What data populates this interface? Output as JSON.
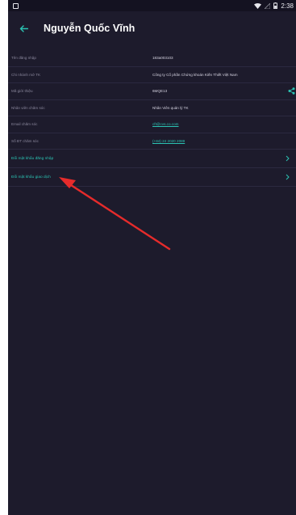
{
  "status_bar": {
    "time": "2:38",
    "wifi_icon": "wifi-icon",
    "battery_icon": "battery-icon"
  },
  "header": {
    "title": "Nguyễn Quốc Vĩnh",
    "back_icon": "back-arrow-icon"
  },
  "info_rows": [
    {
      "label": "Tên đăng nhập",
      "value": "183a003103"
    },
    {
      "label": "Chi nhánh mở TK",
      "value": "Công ty Cổ phần Chứng khoán Kiến Thiết Việt Nam"
    },
    {
      "label": "Mã giới thiệu",
      "value": "6MQE13"
    },
    {
      "label": "Nhân viên chăm sóc",
      "value": "Nhân Viên quản lý TK"
    },
    {
      "label": "Email chăm sóc",
      "value": "cft@cvs.co.com"
    },
    {
      "label": "Số ĐT chăm sóc",
      "value": "(+84) 24 2020 2089"
    }
  ],
  "actions": [
    {
      "label": "Đổi mật khẩu đăng nhập"
    },
    {
      "label": "Đổi mật khẩu giao dịch"
    }
  ],
  "colors": {
    "background": "#1d1b2c",
    "accent": "#2bc3b3",
    "annotation_arrow": "#e62b2b"
  }
}
